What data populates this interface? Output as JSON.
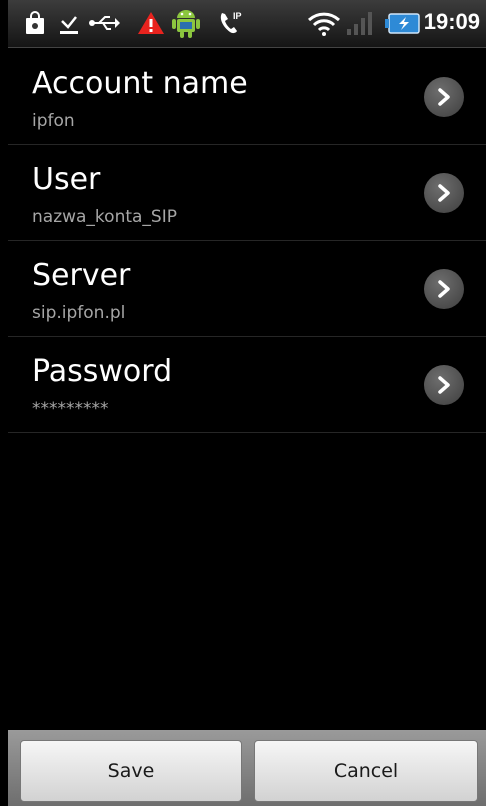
{
  "status_bar": {
    "time": "19:09",
    "icons": [
      "shopping-bag-icon",
      "download-icon",
      "usb-icon",
      "warning-icon",
      "android-icon",
      "sip-call-icon",
      "wifi-icon",
      "signal-icon",
      "battery-icon"
    ],
    "sip_badge": "IP"
  },
  "settings": [
    {
      "title": "Account name",
      "value": "ipfon"
    },
    {
      "title": "User",
      "value": "nazwa_konta_SIP"
    },
    {
      "title": "Server",
      "value": "sip.ipfon.pl"
    },
    {
      "title": "Password",
      "value": "*********"
    }
  ],
  "buttons": {
    "save_label": "Save",
    "cancel_label": "Cancel"
  },
  "colors": {
    "background": "#000000",
    "title_text": "#ffffff",
    "value_text": "#a6a6a6",
    "warning": "#e8231e",
    "android": "#8cc63f",
    "battery": "#2e8ad6"
  }
}
